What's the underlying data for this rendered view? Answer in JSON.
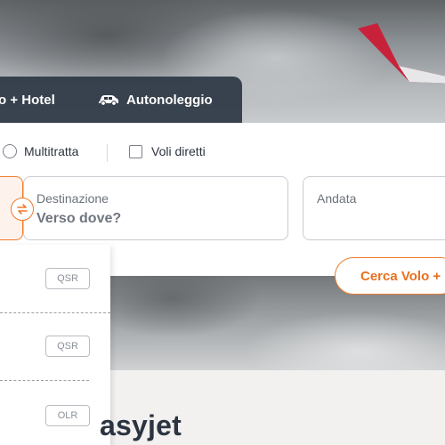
{
  "tabs": {
    "hotel_label": "o + Hotel",
    "car_label": "Autonoleggio"
  },
  "trip_options": {
    "multi_city_label": "Multitratta",
    "direct_flights_label": "Voli diretti"
  },
  "destination": {
    "label": "Destinazione",
    "placeholder": "Verso dove?"
  },
  "departure": {
    "label": "Andata"
  },
  "search": {
    "button_label": "Cerca Volo +"
  },
  "dropdown": {
    "items": [
      {
        "code": "QSR"
      },
      {
        "code": "QSR"
      },
      {
        "code": "OLR"
      }
    ]
  },
  "page": {
    "brand_heading": "asyjet"
  },
  "colors": {
    "accent": "#ef7a2c",
    "tab_bar": "#2c3744",
    "text": "#2b3440"
  },
  "icons": {
    "car": "car-icon",
    "swap": "swap-arrows-icon"
  }
}
